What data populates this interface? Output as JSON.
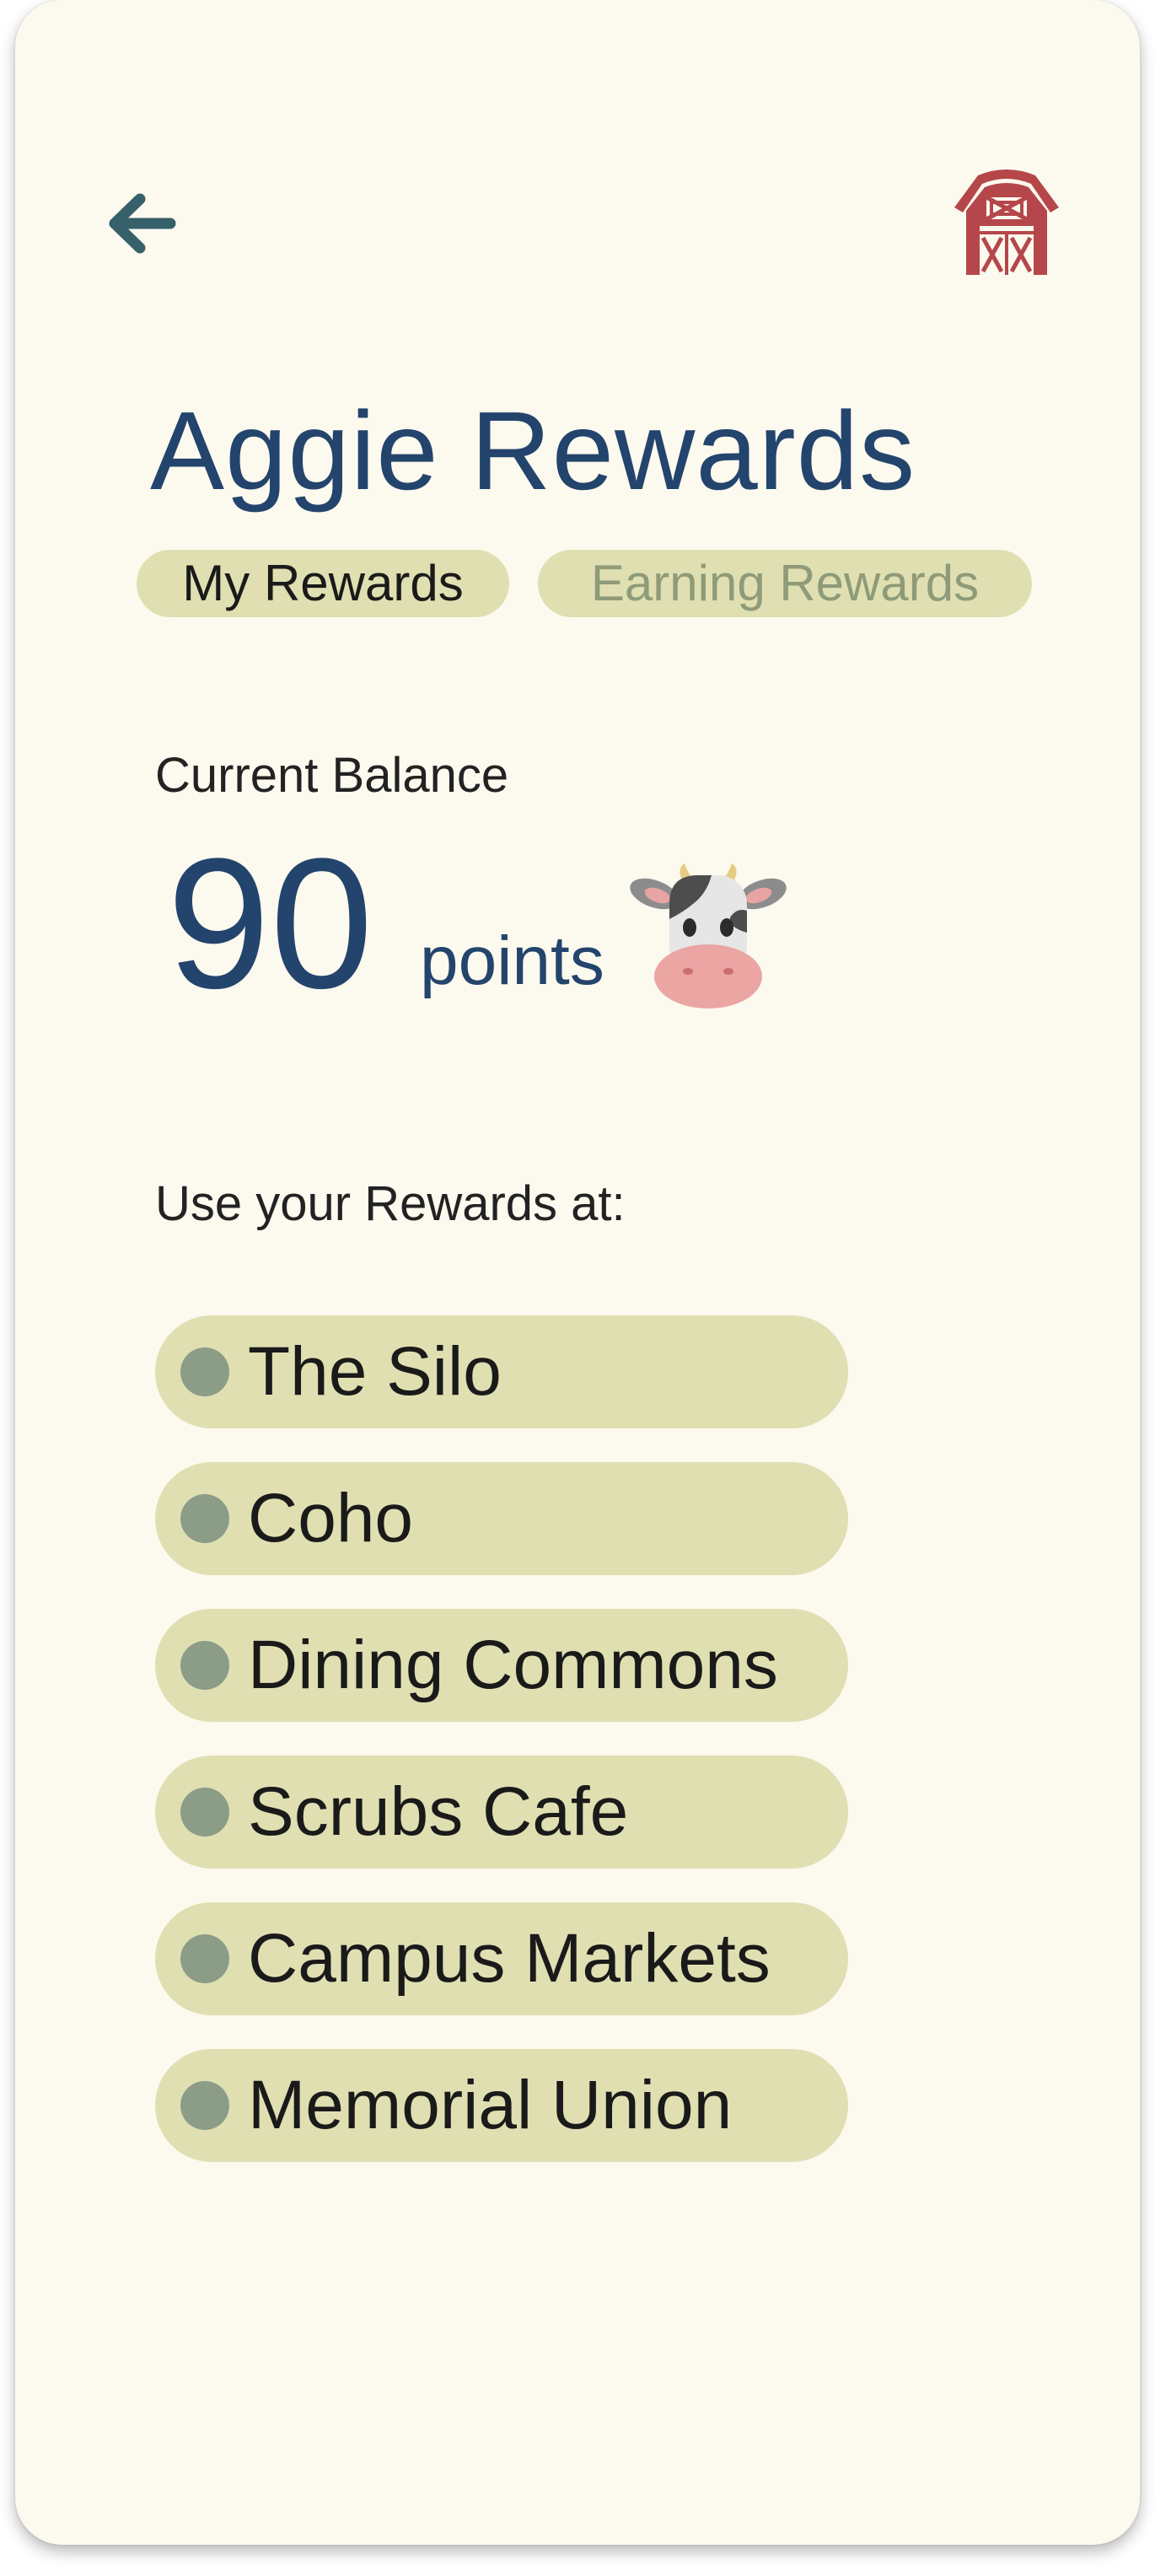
{
  "header": {
    "back_icon": "arrow-left-icon",
    "barn_icon": "barn-icon"
  },
  "title": "Aggie Rewards",
  "tabs": [
    {
      "label": "My Rewards",
      "active": true
    },
    {
      "label": "Earning Rewards",
      "active": false
    }
  ],
  "balance": {
    "label": "Current Balance",
    "value": "90",
    "unit": "points",
    "icon": "cow-icon"
  },
  "locations": {
    "heading": "Use your Rewards at:",
    "items": [
      {
        "label": "The Silo"
      },
      {
        "label": "Coho"
      },
      {
        "label": "Dining Commons"
      },
      {
        "label": "Scrubs Cafe"
      },
      {
        "label": "Campus Markets"
      },
      {
        "label": "Memorial Union"
      }
    ]
  },
  "colors": {
    "background": "#fcf9ee",
    "accent_navy": "#23446c",
    "pill": "#dfdfb2",
    "dot": "#8b9c87",
    "barn_red": "#b5474b",
    "inactive_tab_text": "#8f9b78",
    "back_arrow": "#36606a"
  }
}
